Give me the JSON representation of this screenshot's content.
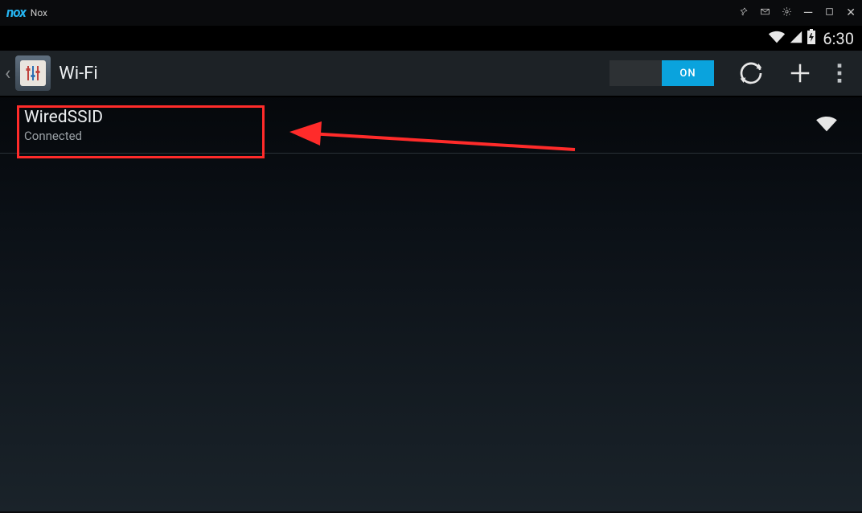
{
  "window": {
    "app_logo_text": "nox",
    "app_title": "Nox"
  },
  "statusbar": {
    "time": "6:30"
  },
  "header": {
    "title": "Wi-Fi",
    "toggle": {
      "on_label": "ON",
      "off_label": ""
    }
  },
  "wifi": {
    "items": [
      {
        "ssid": "WiredSSID",
        "status": "Connected"
      }
    ]
  }
}
